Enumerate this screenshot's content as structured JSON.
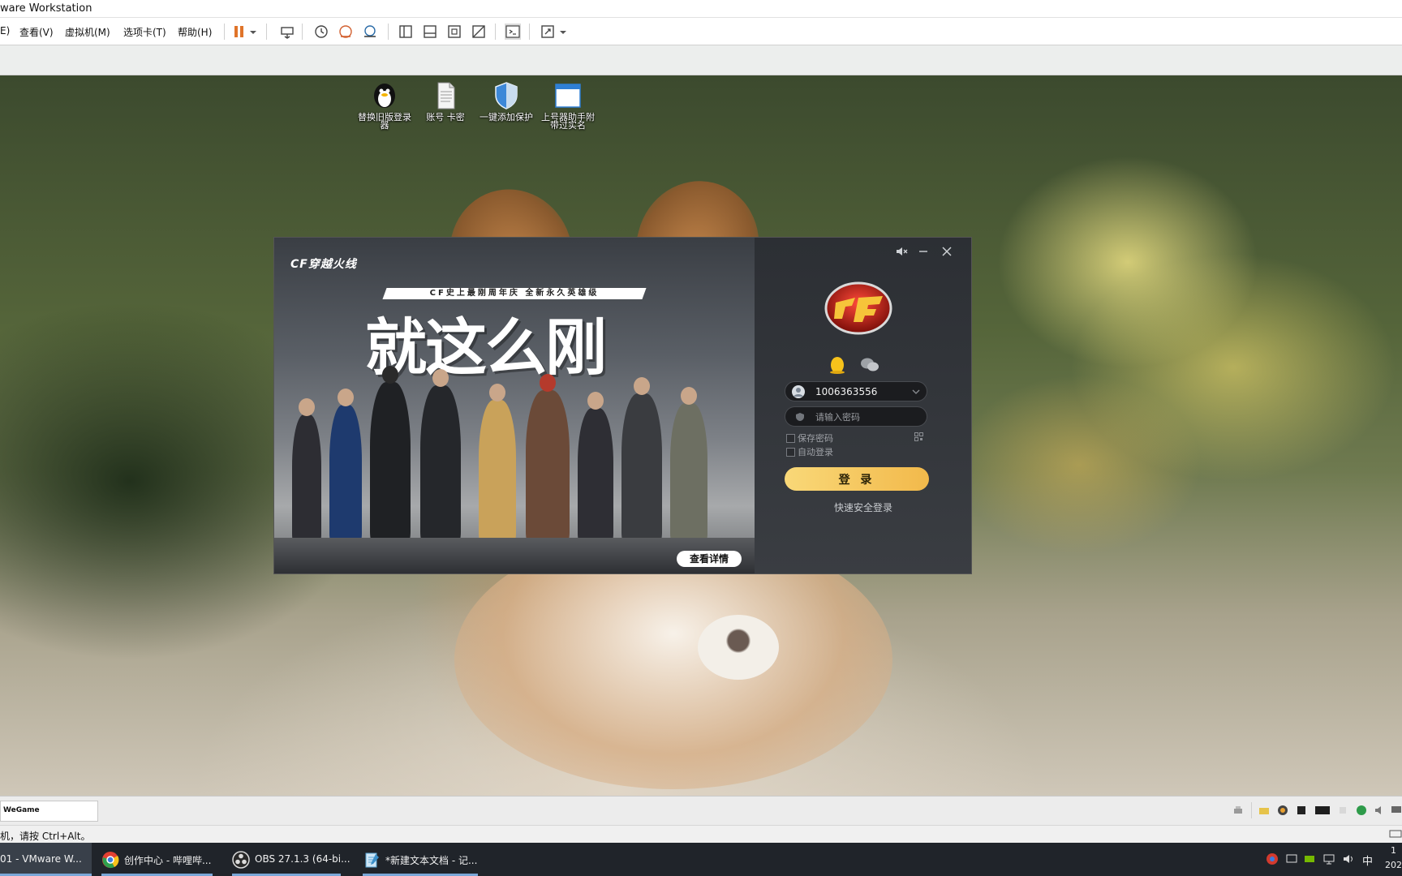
{
  "vmware": {
    "window_title": "ware Workstation",
    "menu": [
      "E)",
      "查看(V)",
      "虚拟机(M)",
      "选项卡(T)",
      "帮助(H)"
    ],
    "toolbar_icons": [
      "pause-icon",
      "dropdown-arrow-icon",
      "send-keys-icon",
      "snapshot-icon",
      "revert-snapshot-icon",
      "snapshot-manager-icon",
      "library-view-icon",
      "thumbnail-bar-icon",
      "fit-guest-icon",
      "unity-icon",
      "console-icon",
      "fullscreen-icon",
      "dropdown-arrow-icon"
    ],
    "thumbnail_tab": "WeGame",
    "status_message": "机，请按 Ctrl+Alt。"
  },
  "desktop": {
    "icons": [
      {
        "label": "替换旧版登录器",
        "icon": "qq-penguin-icon"
      },
      {
        "label": "账号 卡密",
        "icon": "text-file-icon"
      },
      {
        "label": "一键添加保护",
        "icon": "shield-icon"
      },
      {
        "label": "上号器助手附带过实名",
        "icon": "window-app-icon"
      }
    ]
  },
  "cf_login": {
    "brand": "CF穿越火线",
    "banner_ribbon": "CF史上最刚周年庆 全新永久英雄级",
    "banner_headline": "就这么刚",
    "detail_button": "查看详情",
    "account": "1006363556",
    "password_placeholder": "请输入密码",
    "save_password": "保存密码",
    "auto_login": "自动登录",
    "login_button": "登 录",
    "quick_login": "快速安全登录",
    "colors": {
      "login_button": "#f5c55c",
      "panel": "#33363b"
    }
  },
  "taskbar": {
    "items": [
      {
        "label": "01 - VMware W...",
        "icon": "vmware-icon",
        "color": "#2e6db4"
      },
      {
        "label": "创作中心 - 哔哩哔...",
        "icon": "chrome-icon",
        "color": "#e34133"
      },
      {
        "label": "OBS 27.1.3 (64-bi...",
        "icon": "obs-icon",
        "color": "#333333"
      },
      {
        "label": "*新建文本文档 - 记...",
        "icon": "notepad-icon",
        "color": "#5aa6d6"
      }
    ],
    "ime": "中",
    "clock_time": "1",
    "clock_date": "202"
  }
}
